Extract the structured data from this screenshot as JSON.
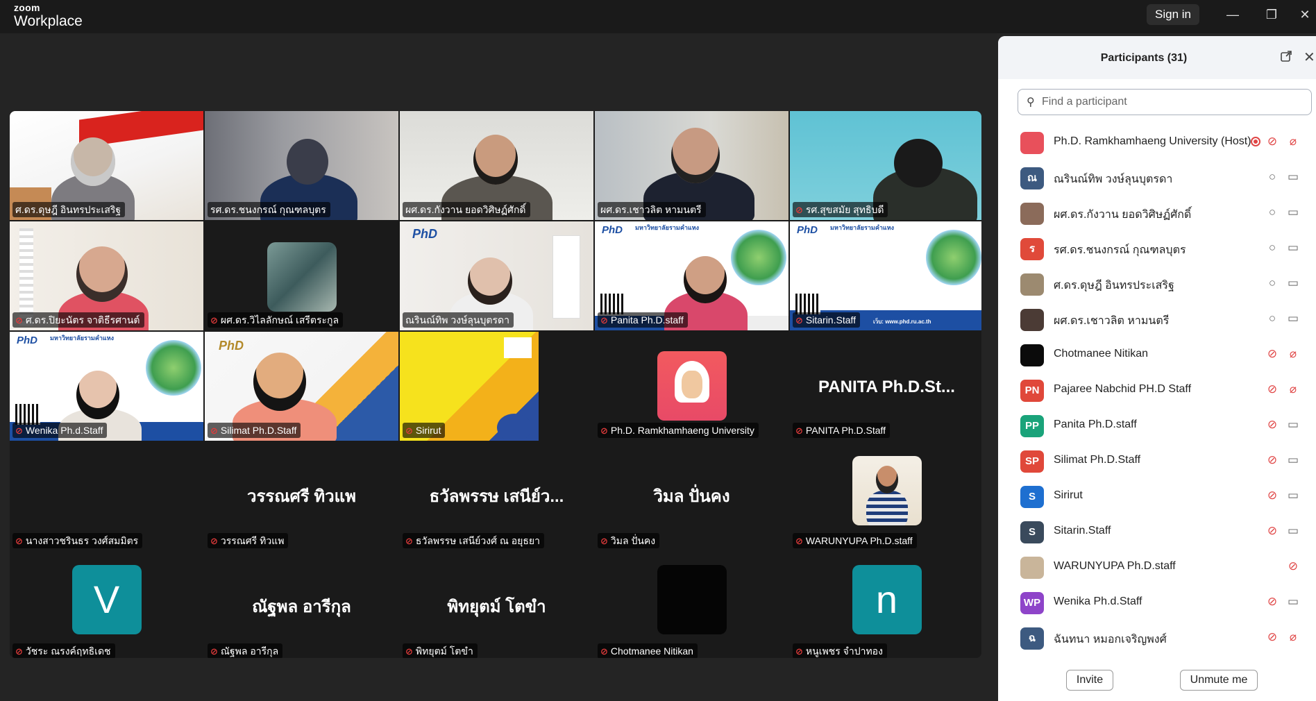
{
  "app": {
    "brand_small": "zoom",
    "brand_name": "Workplace",
    "sign_in": "Sign in"
  },
  "tiles": [
    "ศ.ดร.ดุษฎี  อินทรประเสริฐ",
    "รศ.ดร.ชนงกรณ์  กุณฑลบุตร",
    "ผศ.ดร.กังวาน  ยอดวิศิษฏ์ศักดิ์",
    "ผศ.ดร.เชาวลิต  หามนตรี",
    "รศ.สุขสมัย  สุทธิบดี",
    "ศ.ดร.ปิยะนัตร  จาติธีรศานต์",
    "ผศ.ดร.วิไลลักษณ์  เสรีตระกูล",
    "ณรินณ์ทิพ วงษ์ลุนบุตรดา",
    "Panita Ph.D.staff",
    "Sitarin.Staff",
    "Wenika Ph.d.Staff",
    "Silimat Ph.D.Staff",
    "Sirirut",
    "Ph.D. Ramkhamhaeng University",
    "PANITA Ph.D.Staff",
    "นางสาวชรินธร วงศ์สมมิตร",
    "วรรณศรี  ทิวแพ",
    "ธวัลพรรษ เสนีย์วงศ์ ณ อยุธยา",
    "วิมล ปั่นคง",
    "WARUNYUPA Ph.D.staff",
    "วัชระ ณรงค์ฤทธิเดช",
    "ณัฐพล อารีกุล",
    "พิทยุตม์ โตขำ",
    "Chotmanee Nitikan",
    "หนูเพชร จำปาทอง"
  ],
  "big_names": {
    "panita": "PANITA  Ph.D.St...",
    "wannasri": "วรรณศรี  ทิวแพ",
    "thawan": "ธวัลพรรษ เสนีย์ว...",
    "wimon": "วิมล ปั่นคง",
    "nattapol": "ณัฐพล อารีกุล",
    "phittayut": "พิทยุตม์ โตขำ"
  },
  "avatar_letters": {
    "v": "V",
    "n": "n"
  },
  "banner": {
    "logo": "PhD",
    "university": "มหาวิทยาลัยรามคำแหง",
    "site": "เว็บ: www.phd.ru.ac.th"
  },
  "panel": {
    "title": "Participants (31)",
    "search_placeholder": "Find a participant",
    "invite": "Invite",
    "unmute_me": "Unmute me",
    "participants": [
      {
        "name": "Ph.D. Ramkhamhaeng University (Host)",
        "initials": "",
        "color": "#e8505b",
        "mic": "muted",
        "video": "off"
      },
      {
        "name": "ณรินณ์ทิพ วงษ์ลุนบุตรดา",
        "initials": "ณ",
        "color": "#3d5a80",
        "mic": "on",
        "video": "on"
      },
      {
        "name": "ผศ.ดร.กังวาน  ยอดวิศิษฏ์ศักดิ์",
        "initials": "",
        "color": "#8b6b5a",
        "mic": "on",
        "video": "on"
      },
      {
        "name": "รศ.ดร.ชนงกรณ์  กุณฑลบุตร",
        "initials": "ร",
        "color": "#e04a3a",
        "mic": "on",
        "video": "on"
      },
      {
        "name": "ศ.ดร.ดุษฎี  อินทรประเสริฐ",
        "initials": "",
        "color": "#9c8a70",
        "mic": "on",
        "video": "on"
      },
      {
        "name": "ผศ.ดร.เชาวลิต  หามนตรี",
        "initials": "",
        "color": "#4b3b35",
        "mic": "on",
        "video": "on"
      },
      {
        "name": "Chotmanee Nitikan",
        "initials": "",
        "color": "#0b0b0b",
        "mic": "muted",
        "video": "off"
      },
      {
        "name": "Pajaree Nabchid PH.D Staff",
        "initials": "PN",
        "color": "#e0483a",
        "mic": "muted",
        "video": "off"
      },
      {
        "name": "Panita Ph.D.staff",
        "initials": "PP",
        "color": "#1aa37a",
        "mic": "muted",
        "video": "on"
      },
      {
        "name": "Silimat Ph.D.Staff",
        "initials": "SP",
        "color": "#e0483a",
        "mic": "muted",
        "video": "on"
      },
      {
        "name": "Sirirut",
        "initials": "S",
        "color": "#1e6fd0",
        "mic": "muted",
        "video": "on"
      },
      {
        "name": "Sitarin.Staff",
        "initials": "S",
        "color": "#3a4a5c",
        "mic": "muted",
        "video": "on"
      },
      {
        "name": "WARUNYUPA Ph.D.staff",
        "initials": "",
        "color": "#c9b59a",
        "mic": "muted",
        "video": "none"
      },
      {
        "name": "Wenika Ph.d.Staff",
        "initials": "WP",
        "color": "#8e44c9",
        "mic": "muted",
        "video": "on"
      },
      {
        "name": "ฉันทนา หมอกเจริญพงศ์",
        "initials": "ฉ",
        "color": "#3d5a80",
        "mic": "muted",
        "video": "off"
      }
    ]
  }
}
